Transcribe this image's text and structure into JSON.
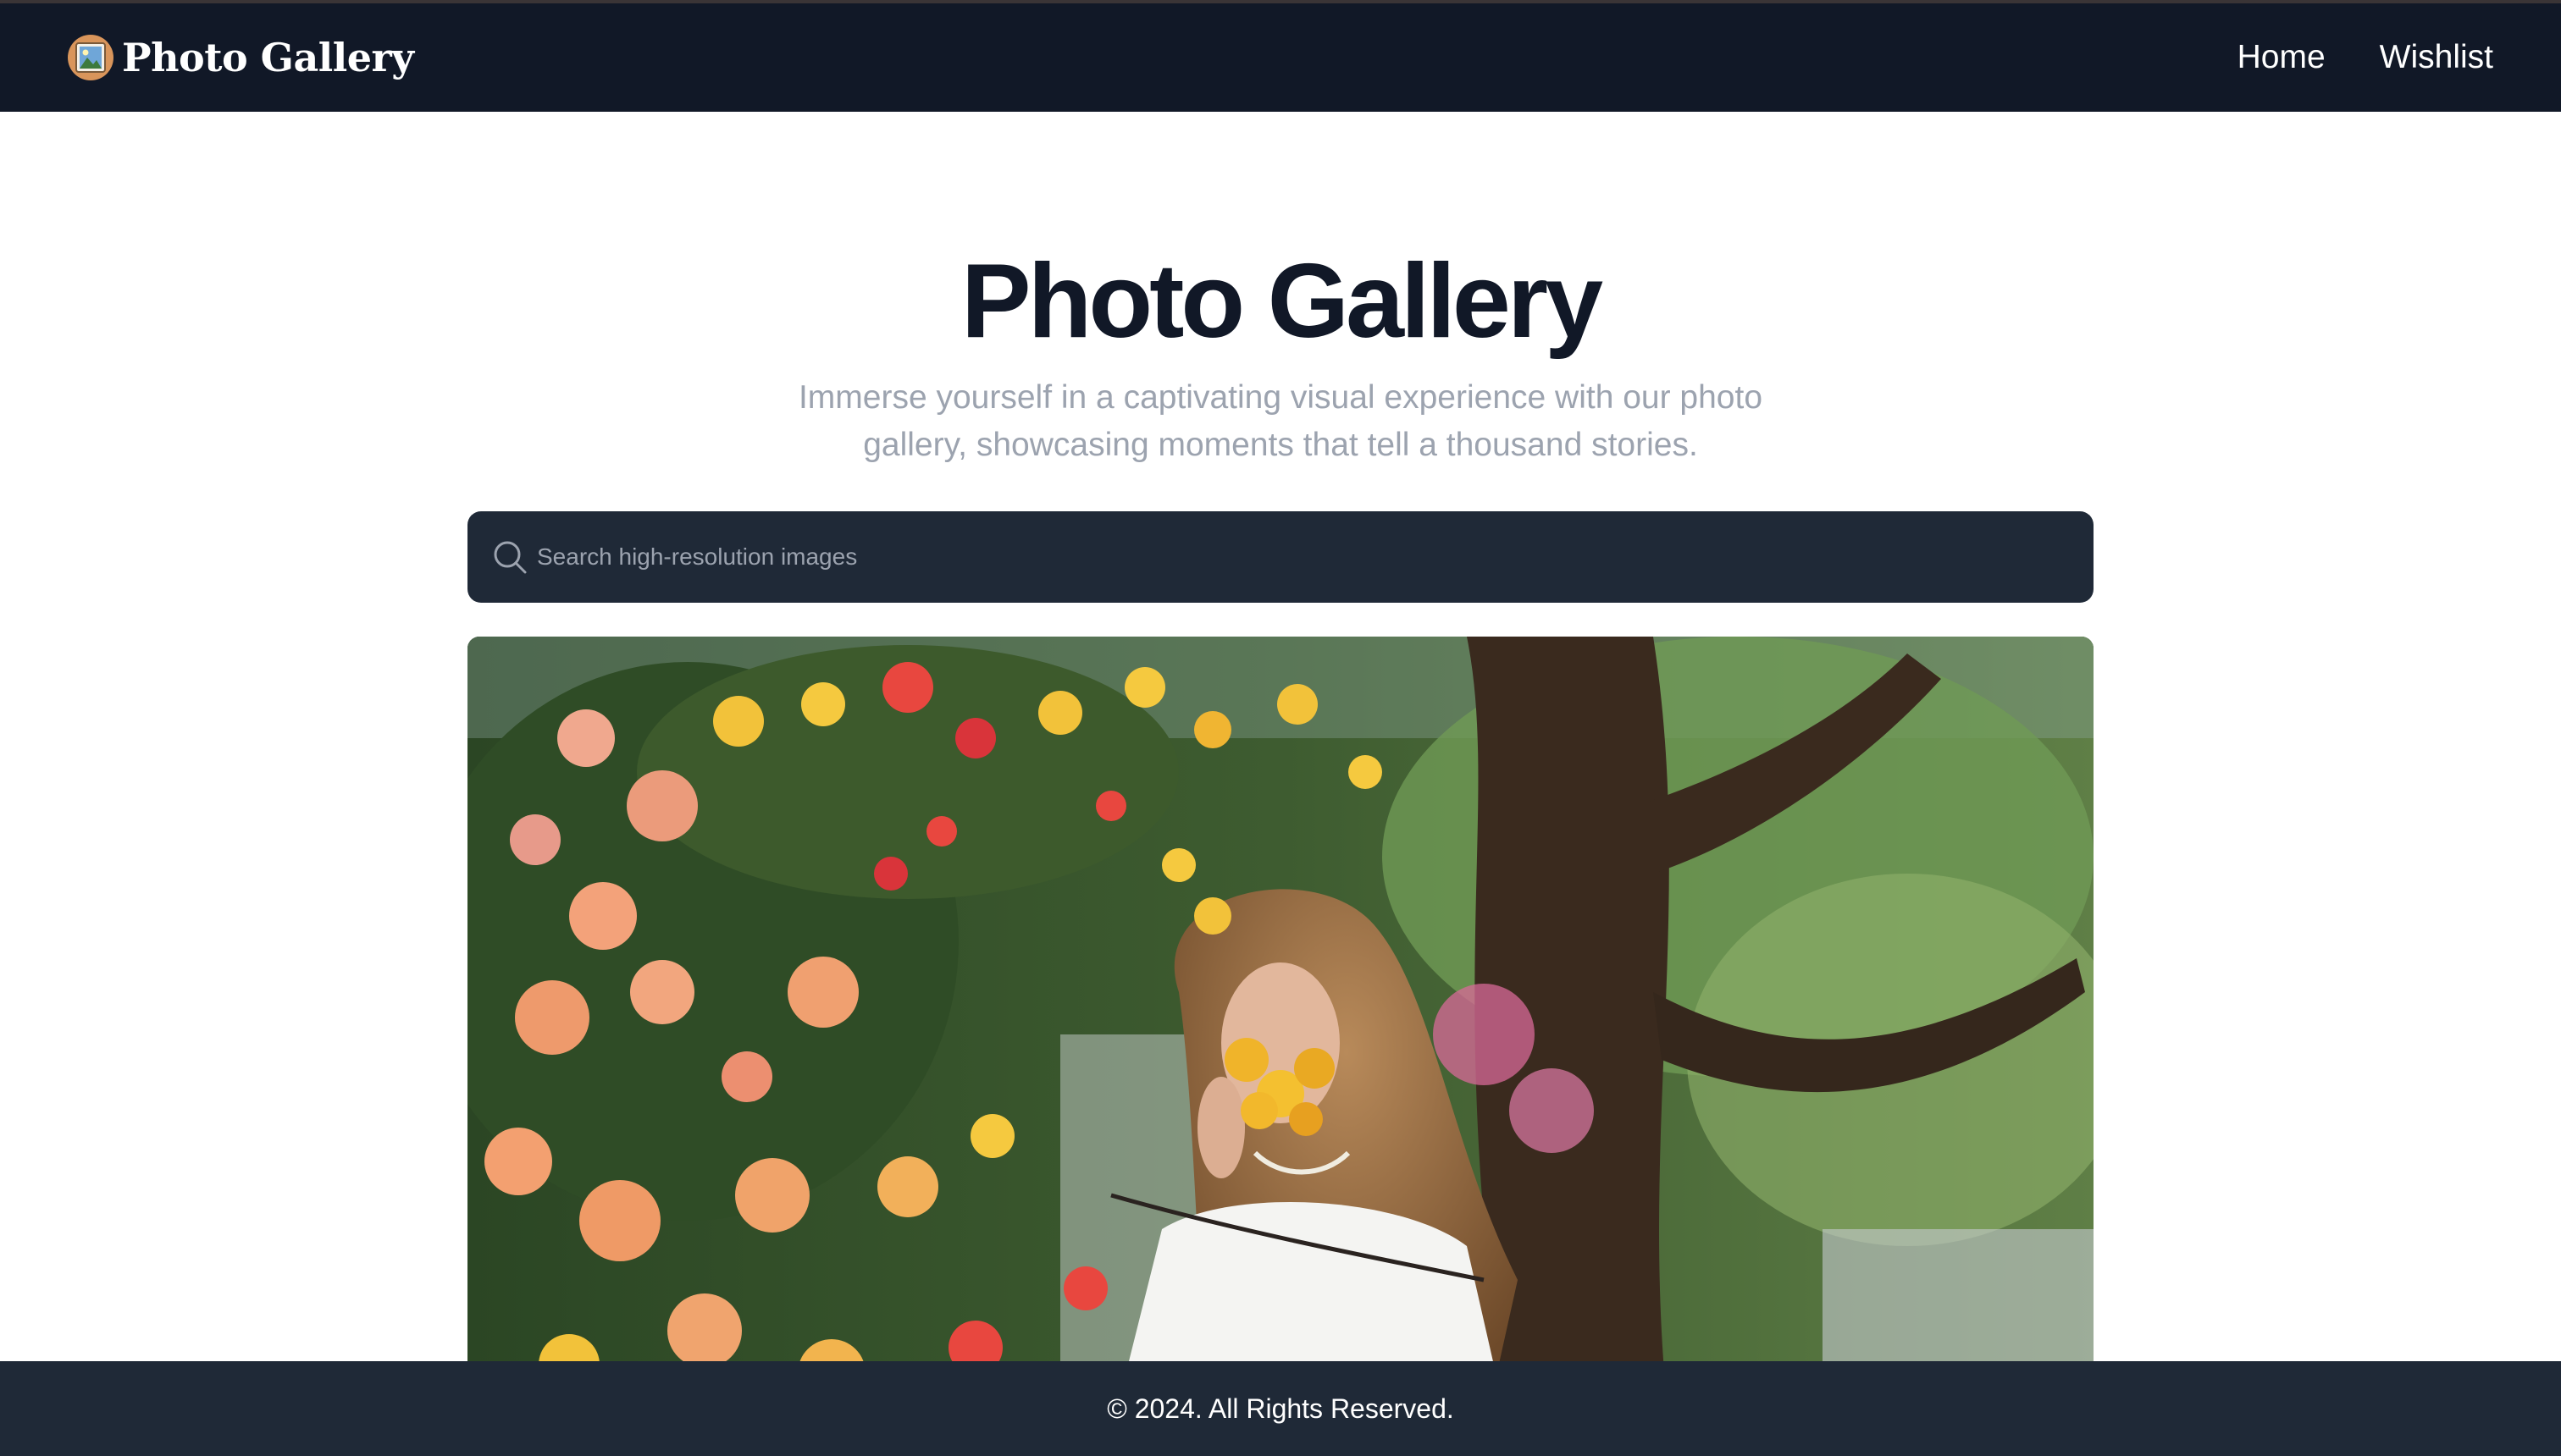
{
  "navbar": {
    "brand_text": "Photo Gallery",
    "brand_icon": "framed-picture-icon",
    "links": [
      {
        "label": "Home"
      },
      {
        "label": "Wishlist"
      }
    ]
  },
  "hero": {
    "title": "Photo Gallery",
    "subtitle_line1": "Immerse yourself in a captivating visual experience with our photo",
    "subtitle_line2": "gallery, showcasing moments that tell a thousand stories."
  },
  "search": {
    "icon": "search-icon",
    "placeholder": "Search high-resolution images",
    "value": ""
  },
  "gallery": {
    "photo_subject": "woman-with-flowers-photo"
  },
  "footer": {
    "text": "© 2024. All Rights Reserved."
  },
  "colors": {
    "navbar_bg": "#111827",
    "search_bg": "#1f2937",
    "footer_bg": "#1f2937",
    "title_text": "#111827",
    "subtitle_text": "#9ca3af"
  }
}
